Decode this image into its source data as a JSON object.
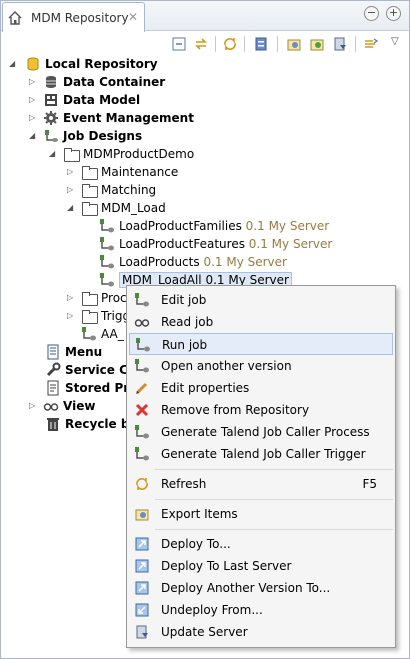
{
  "tab": {
    "title": "MDM Repository",
    "close_glyph": "✕"
  },
  "window_buttons": {
    "minimize": "−",
    "maximize": "+"
  },
  "toolbar": {
    "overflow": "▽"
  },
  "tree": {
    "local_repository": "Local Repository",
    "data_container": "Data Container",
    "data_model": "Data Model",
    "event_management": "Event Management",
    "job_designs": "Job Designs",
    "mdm_product_demo": "MDMProductDemo",
    "maintenance": "Maintenance",
    "matching": "Matching",
    "mdm_load": "MDM_Load",
    "jobs": [
      {
        "name": "LoadProductFamilies",
        "version": "0.1 My Server"
      },
      {
        "name": "LoadProductFeatures",
        "version": "0.1 My Server"
      },
      {
        "name": "LoadProducts",
        "version": "0.1 My Server"
      },
      {
        "name": "MDM_LoadAll",
        "version": "0.1 My Server"
      }
    ],
    "proc_partial": "Proc",
    "trig_partial": "Trigg",
    "aa_partial": "AA_",
    "menu_item": "Menu",
    "service": "Service Co",
    "stored_proc": "Stored Proc",
    "view": "View",
    "recycle_bin": "Recycle bin"
  },
  "context_menu": {
    "edit_job": "Edit job",
    "read_job": "Read job",
    "run_job": "Run job",
    "open_another_version": "Open another version",
    "edit_properties": "Edit properties",
    "remove_from_repository": "Remove from Repository",
    "gen_caller_process": "Generate Talend Job Caller Process",
    "gen_caller_trigger": "Generate Talend Job Caller Trigger",
    "refresh": "Refresh",
    "refresh_shortcut": "F5",
    "export_items": "Export Items",
    "deploy_to": "Deploy To...",
    "deploy_to_last_server": "Deploy To Last Server",
    "deploy_another_version": "Deploy Another Version To...",
    "undeploy_from": "Undeploy From...",
    "update_server": "Update Server"
  }
}
